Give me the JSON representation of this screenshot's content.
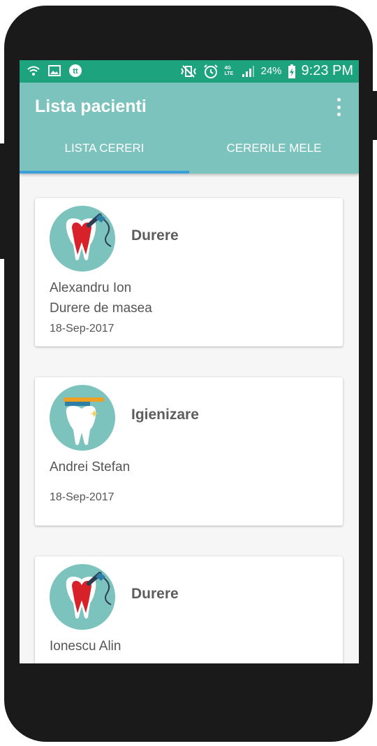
{
  "status_bar": {
    "battery": "24%",
    "time": "9:23 PM",
    "network": "4G LTE"
  },
  "app": {
    "title": "Lista pacienti",
    "tabs": [
      {
        "label": "LISTA CERERI"
      },
      {
        "label": "CERERILE MELE"
      }
    ]
  },
  "cards": [
    {
      "type": "Durere",
      "patient": "Alexandru Ion",
      "description": "Durere de masea",
      "date": "18-Sep-2017",
      "icon": "tooth-drill-icon"
    },
    {
      "type": "Igienizare",
      "patient": "Andrei Stefan",
      "description": "",
      "date": "18-Sep-2017",
      "icon": "tooth-brush-icon"
    },
    {
      "type": "Durere",
      "patient": "Ionescu Alin",
      "description": "",
      "date": "",
      "icon": "tooth-drill-icon"
    }
  ],
  "colors": {
    "status_bar": "#1ea37f",
    "app_bar": "#7cc3bd",
    "tab_indicator": "#3a9ed8",
    "background": "#f6f6f6"
  }
}
